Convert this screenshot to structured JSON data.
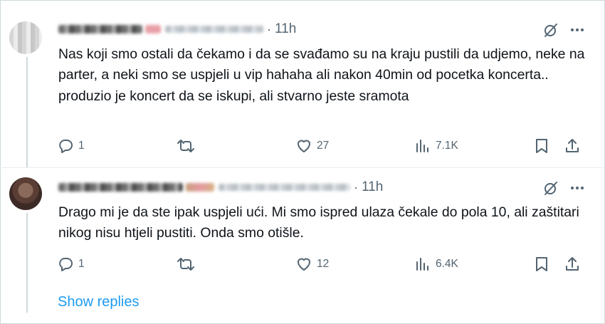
{
  "colors": {
    "text": "#0f1419",
    "secondary": "#536471",
    "accent": "#1d9bf0",
    "border": "#cfd9de"
  },
  "tweets": [
    {
      "time": "11h",
      "text": "Nas koji smo ostali da čekamo i da se svađamo su na kraju pustili da udjemo, neke na parter, a neki smo se uspjeli u vip hahaha ali nakon 40min od pocetka koncerta.. produzio je koncert da se iskupi, ali stvarno jeste sramota",
      "replies": "1",
      "retweets": "",
      "likes": "27",
      "views": "7.1K"
    },
    {
      "time": "11h",
      "text": "Drago mi je da ste ipak uspjeli ući. Mi smo ispred ulaza čekale do pola 10, ali zaštitari nikog nisu htjeli pustiti. Onda smo otišle.",
      "replies": "1",
      "retweets": "",
      "likes": "12",
      "views": "6.4K"
    }
  ],
  "separator": "·",
  "show_replies_label": "Show replies",
  "icons": [
    "grok-icon",
    "more-icon",
    "reply-icon",
    "retweet-icon",
    "like-icon",
    "views-icon",
    "bookmark-icon",
    "share-icon"
  ]
}
